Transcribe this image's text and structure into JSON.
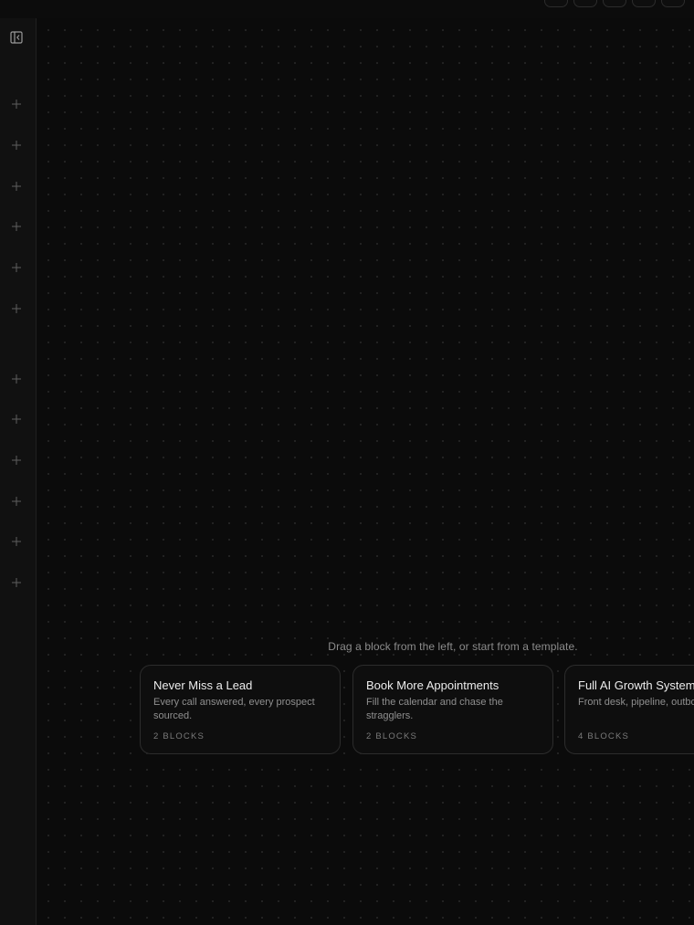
{
  "topbar": {
    "buttons": [
      "toolbar-button-1",
      "toolbar-button-2",
      "toolbar-button-3",
      "toolbar-button-4",
      "toolbar-button-5"
    ]
  },
  "sidebar": {
    "collapse_icon": "panel-collapse-icon",
    "add_icon": "plus-icon",
    "add_buttons_count_group_1": 6,
    "add_buttons_count_group_2": 6
  },
  "canvas": {
    "hint": "Drag a block from the left, or start from a template."
  },
  "templates": [
    {
      "title": "Never Miss a Lead",
      "description": "Every call answered, every prospect sourced.",
      "meta": "2 BLOCKS"
    },
    {
      "title": "Book More Appointments",
      "description": "Fill the calendar and chase the stragglers.",
      "meta": "2 BLOCKS"
    },
    {
      "title": "Full AI Growth System",
      "description": "Front desk, pipeline, outbound, ads.",
      "meta": "4 BLOCKS"
    }
  ],
  "colors": {
    "background": "#0b0b0b",
    "sidebar": "#111111",
    "border": "#2c2c2c",
    "text_primary": "#ececec",
    "text_secondary": "#8f8f8f"
  }
}
